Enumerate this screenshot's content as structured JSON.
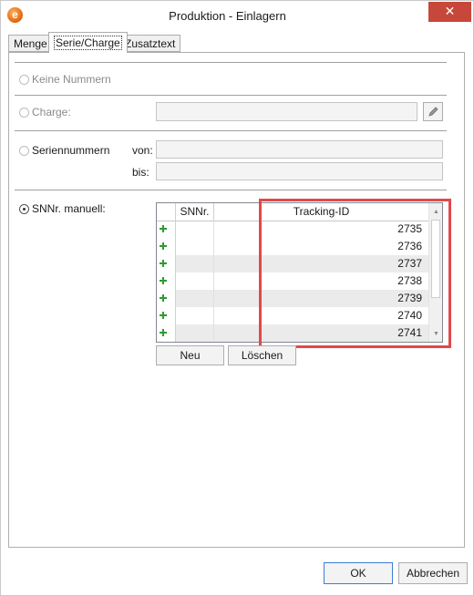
{
  "window": {
    "title": "Produktion - Einlagern",
    "close_glyph": "✕",
    "app_icon_letter": "e"
  },
  "tabs": [
    {
      "label": "Menge",
      "active": false
    },
    {
      "label": "Serie/Charge",
      "active": true
    },
    {
      "label": "Zusatztext",
      "active": false
    }
  ],
  "options": {
    "keine_nummern": {
      "label": "Keine Nummern",
      "selected": false,
      "enabled": false
    },
    "charge": {
      "label": "Charge:",
      "value": "",
      "selected": false,
      "enabled": false
    },
    "seriennummern": {
      "label": "Seriennummern",
      "selected": false,
      "enabled": true,
      "von_label": "von:",
      "von_value": "",
      "bis_label": "bis:",
      "bis_value": ""
    },
    "snnr_manuell": {
      "label": "SNNr. manuell:",
      "selected": true,
      "enabled": true
    }
  },
  "grid": {
    "columns": [
      "SNNr.",
      "Tracking-ID"
    ],
    "rows": [
      {
        "snnr": "",
        "tracking_id": "2735"
      },
      {
        "snnr": "",
        "tracking_id": "2736"
      },
      {
        "snnr": "",
        "tracking_id": "2737"
      },
      {
        "snnr": "",
        "tracking_id": "2738"
      },
      {
        "snnr": "",
        "tracking_id": "2739"
      },
      {
        "snnr": "",
        "tracking_id": "2740"
      },
      {
        "snnr": "",
        "tracking_id": "2741"
      }
    ],
    "scroll_up_glyph": "▲",
    "scroll_down_glyph": "▼"
  },
  "grid_buttons": {
    "new_label": "Neu",
    "delete_label": "Löschen"
  },
  "footer": {
    "ok_label": "OK",
    "cancel_label": "Abbrechen"
  },
  "colors": {
    "highlight": "#e2494b",
    "close_button": "#c7473b",
    "add_icon": "#2e9b2e",
    "ok_border": "#3c7fd4"
  },
  "icons": {
    "edit": "pencil-icon",
    "add_row": "plus-icon"
  }
}
